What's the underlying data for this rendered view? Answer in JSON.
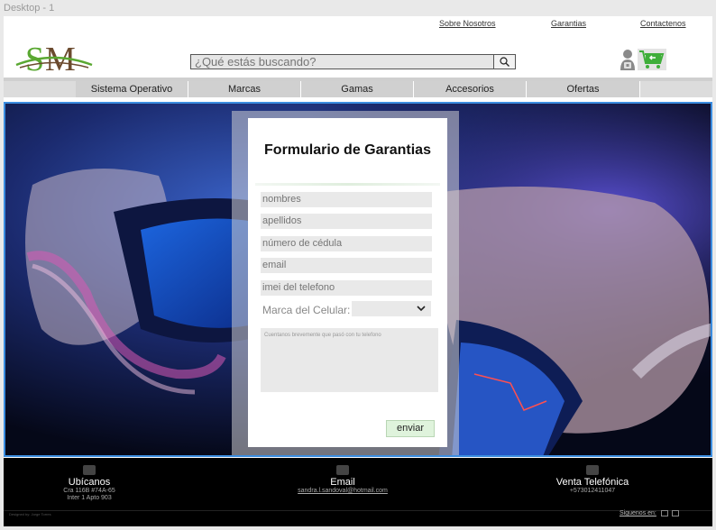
{
  "artboard_label": "Desktop - 1",
  "header": {
    "links": [
      "Sobre Nosotros",
      "Garantias",
      "Contactenos"
    ],
    "logo_text": "SM",
    "search": {
      "placeholder": "¿Qué estás buscando?",
      "icon": "search-icon"
    },
    "icons": [
      "account-icon",
      "shopping-cart-icon"
    ]
  },
  "nav": {
    "items": [
      "Sistema Operativo",
      "Marcas",
      "Gamas",
      "Accesorios",
      "Ofertas"
    ]
  },
  "form": {
    "title": "Formulario de Garantias",
    "fields": [
      "nombres",
      "apellidos",
      "número de cédula",
      "email",
      "imei del telefono"
    ],
    "brand_label": "Marca del Celular:",
    "brand_value": "",
    "textarea_placeholder": "Cuentanos brevemente que pasó con tu telefono",
    "submit_label": "enviar"
  },
  "footer": {
    "locate": {
      "title": "Ubícanos",
      "line1": "Cra 116B #74A-65",
      "line2": "Inter 1 Apto 903",
      "icon": "location-icon"
    },
    "email": {
      "title": "Email",
      "address": "sandra.l.sandoval@hotmail.com",
      "icon": "mail-icon"
    },
    "phone": {
      "title": "Venta Telefónica",
      "number": "+573012411047",
      "icon": "phone-icon"
    },
    "designed_by": "Designed by: Jorge Torres",
    "follow": "Siguenos en:"
  },
  "colors": {
    "accent_border": "#3b8de0",
    "logo_green": "#5aa832",
    "logo_brown": "#6b4a2e",
    "button_green": "#dff3dc"
  }
}
